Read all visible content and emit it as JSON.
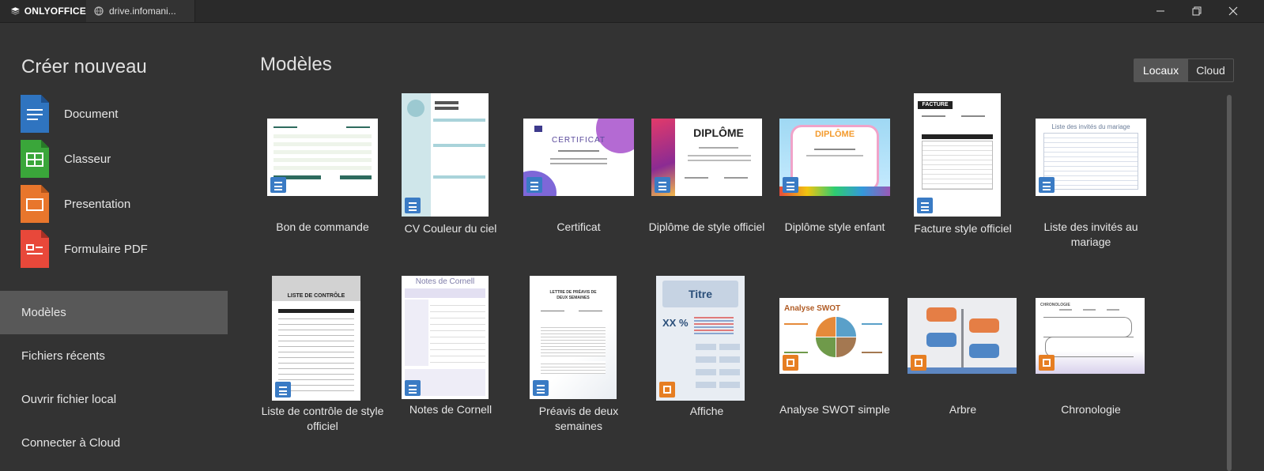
{
  "window": {
    "brand": "ONLYOFFICE",
    "tab_title": "drive.infomani..."
  },
  "sidebar": {
    "title": "Créer nouveau",
    "create_items": [
      {
        "label": "Document",
        "icon": "document-icon",
        "color": "#2f74c0"
      },
      {
        "label": "Classeur",
        "icon": "spreadsheet-icon",
        "color": "#3aa63a"
      },
      {
        "label": "Presentation",
        "icon": "presentation-icon",
        "color": "#e8762c"
      },
      {
        "label": "Formulaire PDF",
        "icon": "pdf-form-icon",
        "color": "#e8483a"
      }
    ],
    "nav": [
      {
        "label": "Modèles",
        "active": true
      },
      {
        "label": "Fichiers récents",
        "active": false
      },
      {
        "label": "Ouvrir fichier local",
        "active": false
      },
      {
        "label": "Connecter à Cloud",
        "active": false
      }
    ]
  },
  "main": {
    "title": "Modèles",
    "toggle": {
      "local": "Locaux",
      "cloud": "Cloud",
      "selected": "Locaux"
    },
    "templates": [
      {
        "label": "Bon de commande",
        "type": "document"
      },
      {
        "label": "CV Couleur du ciel",
        "type": "document"
      },
      {
        "label": "Certificat",
        "type": "document",
        "thumb_title": "CERTIFICAT"
      },
      {
        "label": "Diplôme de style officiel",
        "type": "document",
        "thumb_title": "DIPLÔME"
      },
      {
        "label": "Diplôme style enfant",
        "type": "document",
        "thumb_title": "DIPLÔME"
      },
      {
        "label": "Facture style officiel",
        "type": "document",
        "thumb_title": "FACTURE"
      },
      {
        "label": "Liste des invités au mariage",
        "type": "document",
        "thumb_title": "Liste des invités du mariage"
      },
      {
        "label": "Liste de contrôle de style officiel",
        "type": "document",
        "thumb_title": "LISTE DE CONTRÔLE"
      },
      {
        "label": "Notes de Cornell",
        "type": "document",
        "thumb_title": "Notes de Cornell"
      },
      {
        "label": "Préavis de deux semaines",
        "type": "document",
        "thumb_title": "LETTRE DE PRÉAVIS DE DEUX SEMAINES"
      },
      {
        "label": "Affiche",
        "type": "presentation",
        "thumb_title": "Titre",
        "thumb_value": "XX %"
      },
      {
        "label": "Analyse SWOT simple",
        "type": "presentation",
        "thumb_title": "Analyse SWOT"
      },
      {
        "label": "Arbre",
        "type": "presentation"
      },
      {
        "label": "Chronologie",
        "type": "presentation",
        "thumb_title": "CHRONOLOGIE"
      }
    ]
  },
  "colors": {
    "background": "#333333",
    "titlebar": "#2a2a2a",
    "active_nav": "#585858",
    "doc_badge": "#3a7bc4",
    "pres_badge": "#e67e22"
  }
}
